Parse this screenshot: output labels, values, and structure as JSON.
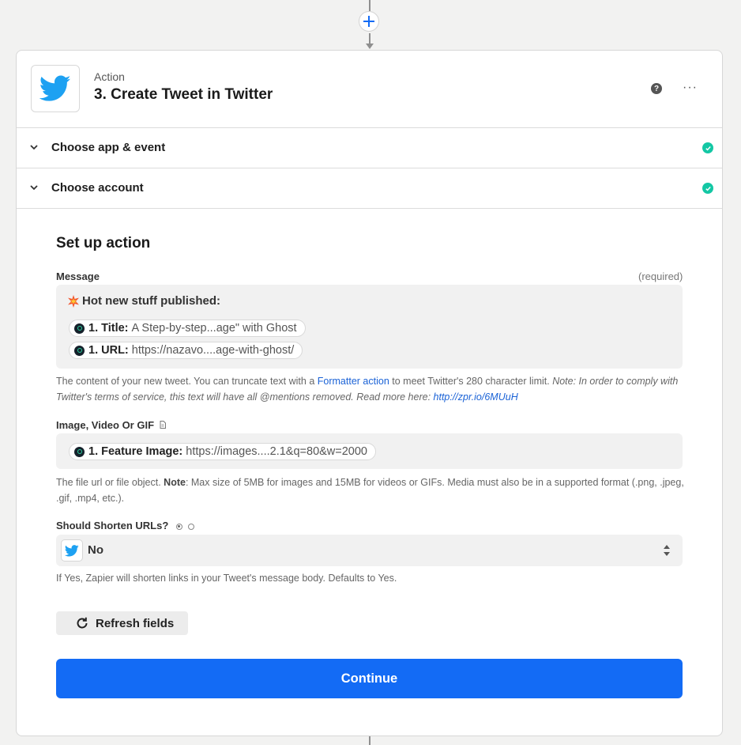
{
  "step": {
    "kind": "Action",
    "title": "3. Create Tweet in Twitter",
    "help_glyph": "?",
    "more_glyph": "···"
  },
  "sections": [
    {
      "label": "Choose app & event"
    },
    {
      "label": "Choose account"
    }
  ],
  "setup": {
    "title": "Set up action",
    "message": {
      "label": "Message",
      "required": "(required)",
      "first_line": "Hot new stuff published:",
      "pills": [
        {
          "key": "1. Title:",
          "value": "A Step-by-step...age\" with Ghost"
        },
        {
          "key": "1. URL:",
          "value": "https://nazavo....age-with-ghost/"
        }
      ],
      "help_part1": "The content of your new tweet. You can truncate text with a ",
      "help_link": "Formatter action",
      "help_part2": " to meet Twitter's 280 character limit. ",
      "help_italic1": "Note: In order to comply with Twitter's terms of service, this text will have all @mentions removed. Read more here: ",
      "help_url": "http://zpr.io/6MUuH"
    },
    "image": {
      "label": "Image, Video Or GIF",
      "pill": {
        "key": "1. Feature Image:",
        "value": "https://images....2.1&q=80&w=2000"
      },
      "help_part1": "The file url or file object. ",
      "help_bold": "Note",
      "help_part2": ": Max size of 5MB for images and 15MB for videos or GIFs. Media must also be in a supported format (.png, .jpeg, .gif, .mp4, etc.)."
    },
    "shorten": {
      "label": "Should Shorten URLs?",
      "selected": "No",
      "help": "If Yes, Zapier will shorten links in your Tweet's message body. Defaults to Yes."
    },
    "refresh_label": "Refresh fields",
    "continue_label": "Continue"
  },
  "colors": {
    "accent": "#136bf5",
    "success": "#13c7a4",
    "twitter": "#1da1f2",
    "link": "#1a62d6"
  }
}
